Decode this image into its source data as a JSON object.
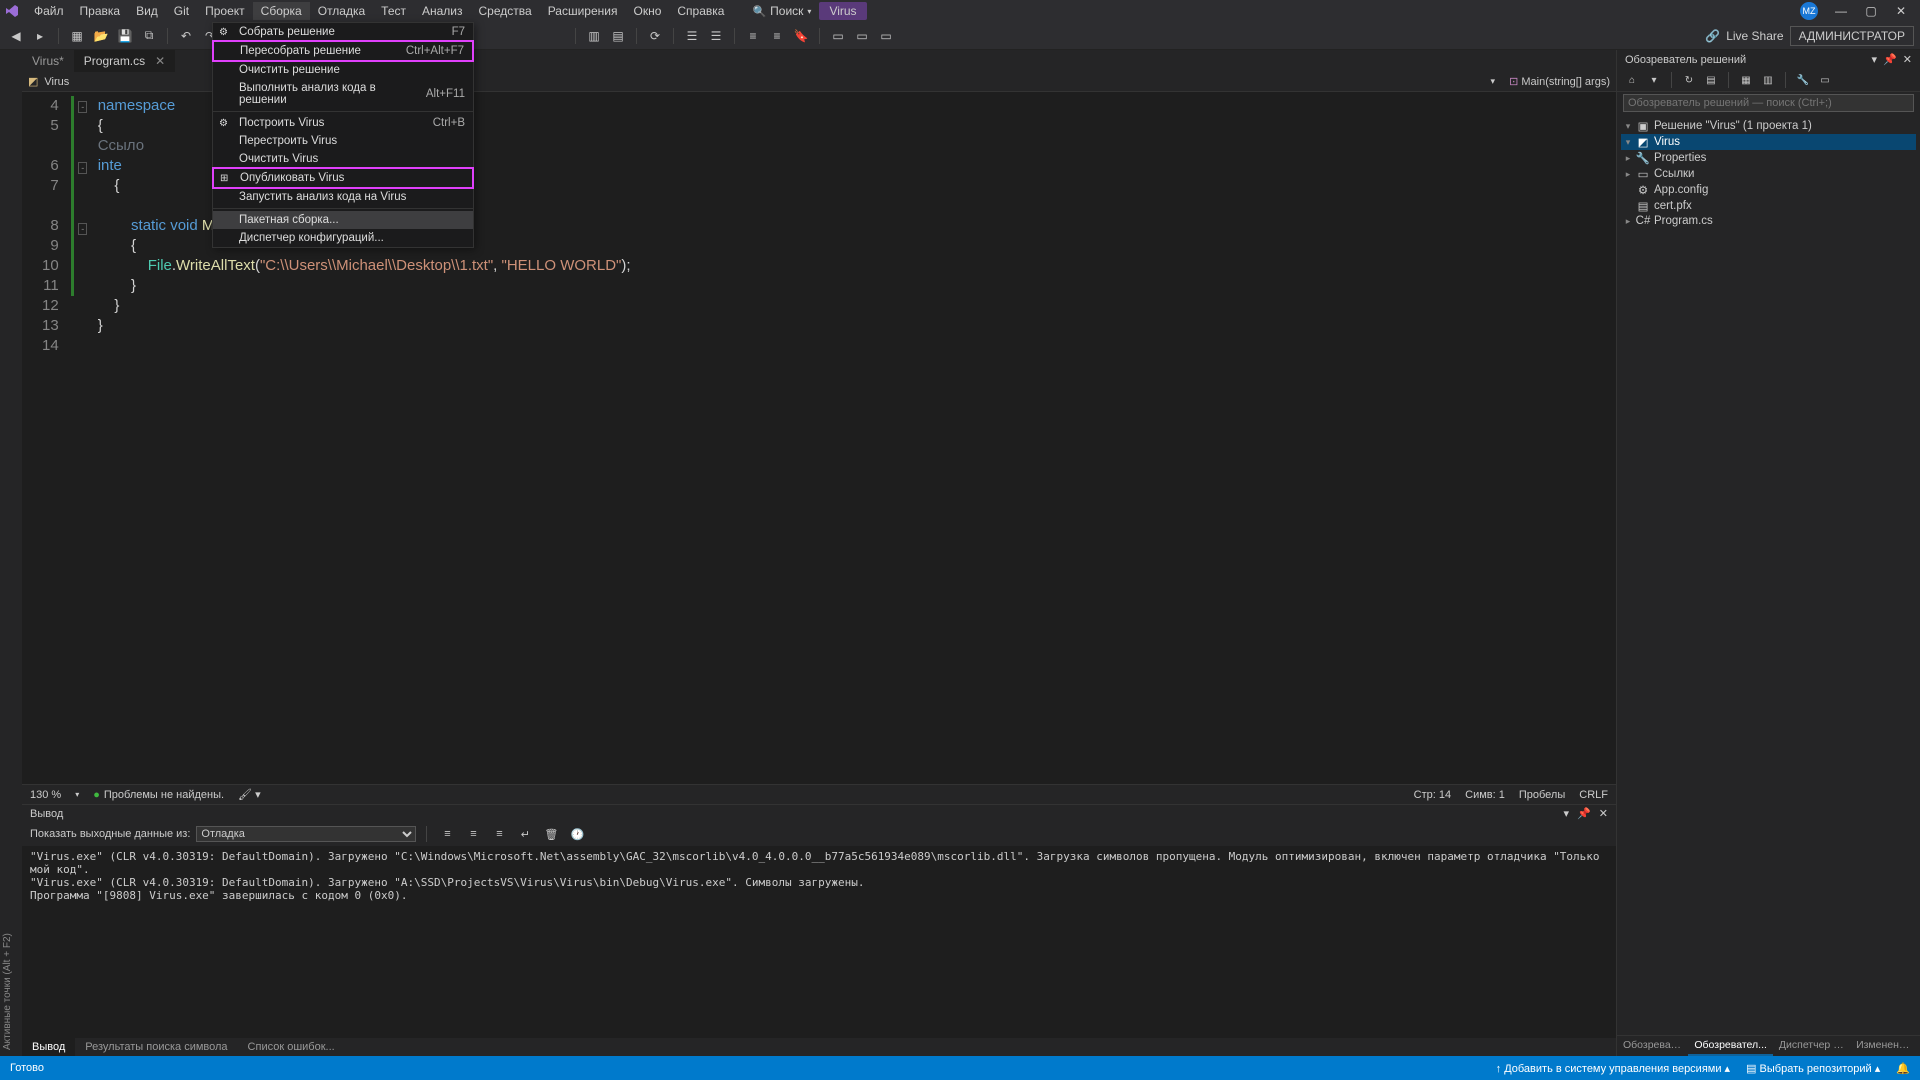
{
  "title": {
    "search": "Поиск",
    "target": "Virus"
  },
  "menu": [
    "Файл",
    "Правка",
    "Вид",
    "Git",
    "Проект",
    "Сборка",
    "Отладка",
    "Тест",
    "Анализ",
    "Средства",
    "Расширения",
    "Окно",
    "Справка"
  ],
  "toolbar": {
    "liveshare": "Live Share",
    "admin": "АДМИНИСТРАТОР",
    "avatar": "MZ"
  },
  "doctabs": [
    {
      "name": "Virus*"
    },
    {
      "name": "Program.cs"
    }
  ],
  "breadcrumb": {
    "project": "Virus",
    "member": "Main(string[] args)"
  },
  "code": {
    "lines": [
      {
        "n": 4,
        "fold": "-",
        "html": "<span class='kw'>namespace</span>"
      },
      {
        "n": 5,
        "fold": "",
        "html": "<span class='punc'>{</span>"
      },
      {
        "n": "",
        "fold": "",
        "html": "<span class='ident' style='color:#6a737d'>Ссыло</span>"
      },
      {
        "n": 6,
        "fold": "-",
        "html": "<span class='kw'>inte</span>"
      },
      {
        "n": 7,
        "fold": "",
        "html": "    <span class='punc'>{</span>"
      },
      {
        "n": "",
        "fold": "",
        "html": ""
      },
      {
        "n": 8,
        "fold": "-",
        "html": "        <span class='kw'>static</span> <span class='kw'>void</span> <span class='mname'>Main</span><span class='punc'>(</span><span class='kw'>string</span><span class='punc'>[]</span> <span class='ident'>args</span><span class='punc'>)</span>"
      },
      {
        "n": 9,
        "fold": "",
        "html": "        <span class='punc'>{</span>"
      },
      {
        "n": 10,
        "fold": "",
        "html": "            <span class='type'>File</span><span class='punc'>.</span><span class='mname'>WriteAllText</span><span class='punc'>(</span><span class='str'>\"C:\\\\Users\\\\Michael\\\\Desktop\\\\1.txt\"</span><span class='punc'>, </span><span class='str'>\"HELLO WORLD\"</span><span class='punc'>);</span>"
      },
      {
        "n": 11,
        "fold": "",
        "html": "        <span class='punc'>}</span>"
      },
      {
        "n": 12,
        "fold": "",
        "html": "    <span class='punc'>}</span>"
      },
      {
        "n": 13,
        "fold": "",
        "html": "<span class='punc'>}</span>"
      },
      {
        "n": 14,
        "fold": "",
        "html": ""
      }
    ]
  },
  "code_status": {
    "zoom": "130 %",
    "problems": "Проблемы не найдены.",
    "line": "Стр: 14",
    "col": "Симв: 1",
    "spaces": "Пробелы",
    "crlf": "CRLF"
  },
  "ctxmenu": [
    {
      "label": "Собрать решение",
      "shortcut": "F7",
      "icon": "⚙"
    },
    {
      "label": "Пересобрать решение",
      "shortcut": "Ctrl+Alt+F7",
      "style": "highlighted"
    },
    {
      "label": "Очистить решение"
    },
    {
      "label": "Выполнить анализ кода в решении",
      "shortcut": "Alt+F11"
    },
    {
      "sep": true
    },
    {
      "label": "Построить Virus",
      "shortcut": "Ctrl+B",
      "icon": "⚙"
    },
    {
      "label": "Перестроить Virus"
    },
    {
      "label": "Очистить Virus"
    },
    {
      "label": "Опубликовать Virus",
      "style": "highlighted",
      "icon": "⊞"
    },
    {
      "label": "Запустить анализ кода на Virus"
    },
    {
      "sep": true
    },
    {
      "label": "Пакетная сборка...",
      "style": "hover"
    },
    {
      "label": "Диспетчер конфигураций..."
    }
  ],
  "output": {
    "title": "Вывод",
    "sourcelabel": "Показать выходные данные из:",
    "source": "Отладка",
    "body": "\"Virus.exe\" (CLR v4.0.30319: DefaultDomain). Загружено \"C:\\Windows\\Microsoft.Net\\assembly\\GAC_32\\mscorlib\\v4.0_4.0.0.0__b77a5c561934e089\\mscorlib.dll\". Загрузка символов пропущена. Модуль оптимизирован, включен параметр отладчика \"Только мой код\".\n\"Virus.exe\" (CLR v4.0.30319: DefaultDomain). Загружено \"A:\\SSD\\ProjectsVS\\Virus\\Virus\\bin\\Debug\\Virus.exe\". Символы загружены.\nПрограмма \"[9808] Virus.exe\" завершилась с кодом 0 (0x0).",
    "tabs": [
      "Вывод",
      "Результаты поиска символа",
      "Список ошибок..."
    ]
  },
  "solexp": {
    "title": "Обозреватель решений",
    "search_placeholder": "Обозреватель решений — поиск (Ctrl+;)",
    "tree": [
      {
        "indent": 0,
        "exp": "▾",
        "ic": "▣",
        "label": "Решение \"Virus\" (1 проекта 1)"
      },
      {
        "indent": 1,
        "exp": "▾",
        "ic": "◩",
        "label": "Virus",
        "selected": true
      },
      {
        "indent": 2,
        "exp": "▸",
        "ic": "🔧",
        "label": "Properties"
      },
      {
        "indent": 2,
        "exp": "▸",
        "ic": "▭",
        "label": "Ссылки"
      },
      {
        "indent": 2,
        "exp": "",
        "ic": "⚙",
        "label": "App.config"
      },
      {
        "indent": 2,
        "exp": "",
        "ic": "▤",
        "label": "cert.pfx"
      },
      {
        "indent": 2,
        "exp": "▸",
        "ic": "C#",
        "label": "Program.cs"
      }
    ],
    "btabs": [
      "Обозревател...",
      "Обозревател...",
      "Диспетчер сво...",
      "Изменения Git"
    ]
  },
  "statusbar": {
    "ready": "Готово",
    "addgit": "Добавить в систему управления версиями",
    "selectrepo": "Выбрать репозиторий"
  },
  "leftgutter": "Активные точки (Alt + F2)"
}
